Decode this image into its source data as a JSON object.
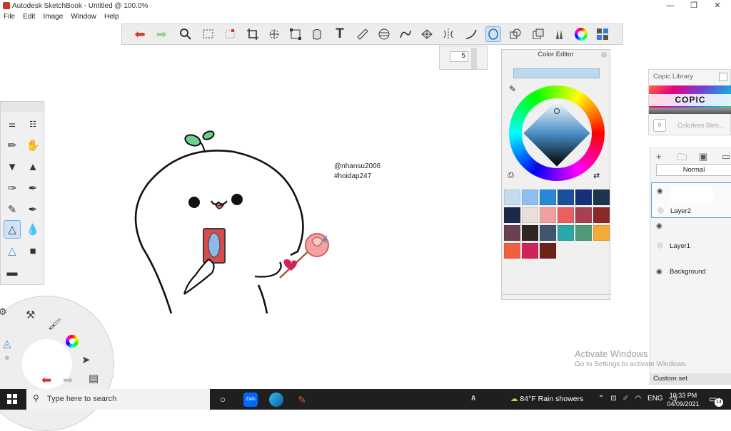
{
  "window": {
    "title": "Autodesk SketchBook - Untitled @ 100.0%",
    "controls": {
      "minimize": "—",
      "restore": "❐",
      "close": "✕"
    }
  },
  "menu": [
    "File",
    "Edit",
    "Image",
    "Window",
    "Help"
  ],
  "toolbar": {
    "tools": [
      "undo-icon",
      "redo-icon",
      "zoom-icon",
      "rect-select-icon",
      "lasso-select-icon",
      "crop-icon",
      "transform-icon",
      "distort-icon",
      "fill-icon",
      "text-icon",
      "ruler-icon",
      "ellipse-icon",
      "french-curve-icon",
      "perspective-icon",
      "symmetry-icon",
      "stroke-icon",
      "brush-palette-icon",
      "shape-icon",
      "layer-icon",
      "brush-library-icon",
      "color-wheel-icon",
      "copic-icon"
    ],
    "active_tool": "brush-palette-icon"
  },
  "brush_size": {
    "value": "5"
  },
  "color_editor": {
    "title": "Color Editor",
    "current_color": "#bcd8ee",
    "swatches": [
      "#c5dbf0",
      "#8fbff0",
      "#2b86d4",
      "#1d4fa0",
      "#17307a",
      "#1e3550",
      "#1b2a4a",
      "#eadfd8",
      "#f0a0a0",
      "#e86060",
      "#a84050",
      "#8c2828",
      "#6b4050",
      "#2f2524",
      "#3f5570",
      "#2aa8a8",
      "#4f9a78",
      "#f7a83a",
      "#f06040",
      "#d0235a",
      "#6a2418"
    ]
  },
  "copic_library": {
    "title": "Copic Library",
    "logo_text": "COPIC",
    "colorless_label": "Colorless Blen...",
    "colorless_code": "0"
  },
  "layers": {
    "blend_mode": "Normal",
    "items": [
      {
        "name": "Layer2",
        "selected": true
      },
      {
        "name": "Layer1",
        "selected": false
      },
      {
        "name": "Background",
        "selected": false
      }
    ],
    "custom_set_label": "Custom set"
  },
  "canvas": {
    "watermark_line1": "@nhansu2006",
    "watermark_line2": "#hoidap247"
  },
  "activate_windows": {
    "title": "Activate Windows",
    "subtitle": "Go to Settings to activate Windows."
  },
  "taskbar": {
    "search_placeholder": "Type here to search",
    "weather": "84°F  Rain showers",
    "language": "ENG",
    "time": "10:33 PM",
    "date": "04/09/2021",
    "notification_count": "14",
    "apps": [
      "task-view-icon",
      "zalo-icon",
      "edge-icon",
      "sketchbook-icon"
    ],
    "zalo_label": "Zalo"
  }
}
